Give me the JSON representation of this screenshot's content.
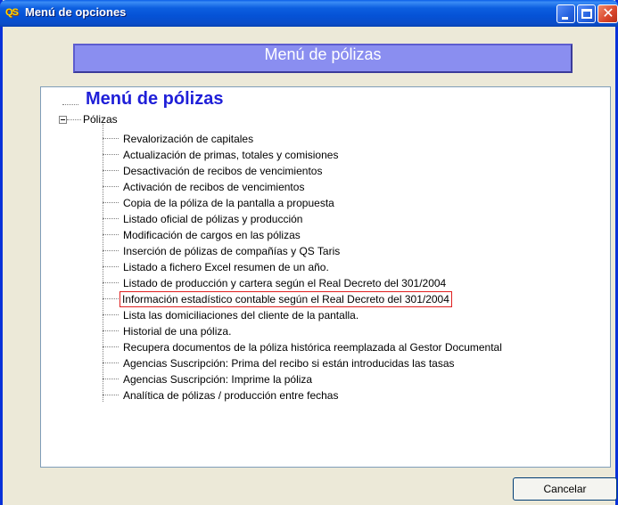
{
  "window": {
    "title": "Menú de opciones",
    "app_icon_text": "QS"
  },
  "banner": {
    "title": "Menú de pólizas"
  },
  "tree": {
    "root_label": "Menú de pólizas",
    "group_label": "Pólizas",
    "selected_index": 10,
    "items": [
      "Revalorización de capitales",
      "Actualización de primas, totales y comisiones",
      "Desactivación de recibos de vencimientos",
      "Activación de recibos de vencimientos",
      "Copia de la póliza de la pantalla a propuesta",
      "Listado oficial de pólizas y producción",
      "Modificación de cargos en las pólizas",
      "Inserción de pólizas de compañías y QS Taris",
      "Listado a fichero Excel resumen de un año.",
      "Listado de producción y cartera según el Real Decreto del 301/2004",
      "Información estadístico contable según el Real Decreto del 301/2004",
      "Lista las domiciliaciones del cliente de la pantalla.",
      "Historial de una póliza.",
      "Recupera documentos de la póliza histórica reemplazada al Gestor Documental",
      "Agencias Suscripción: Prima del recibo si están introducidas las tasas",
      "Agencias Suscripción: Imprime la póliza",
      "Analítica de pólizas / producción entre fechas"
    ]
  },
  "buttons": {
    "cancel_label": "Cancelar"
  },
  "colors": {
    "titlebar": "#0552d6",
    "banner": "#8a8ef0",
    "root_label": "#1f1fd8",
    "selection_border": "#e02020"
  }
}
